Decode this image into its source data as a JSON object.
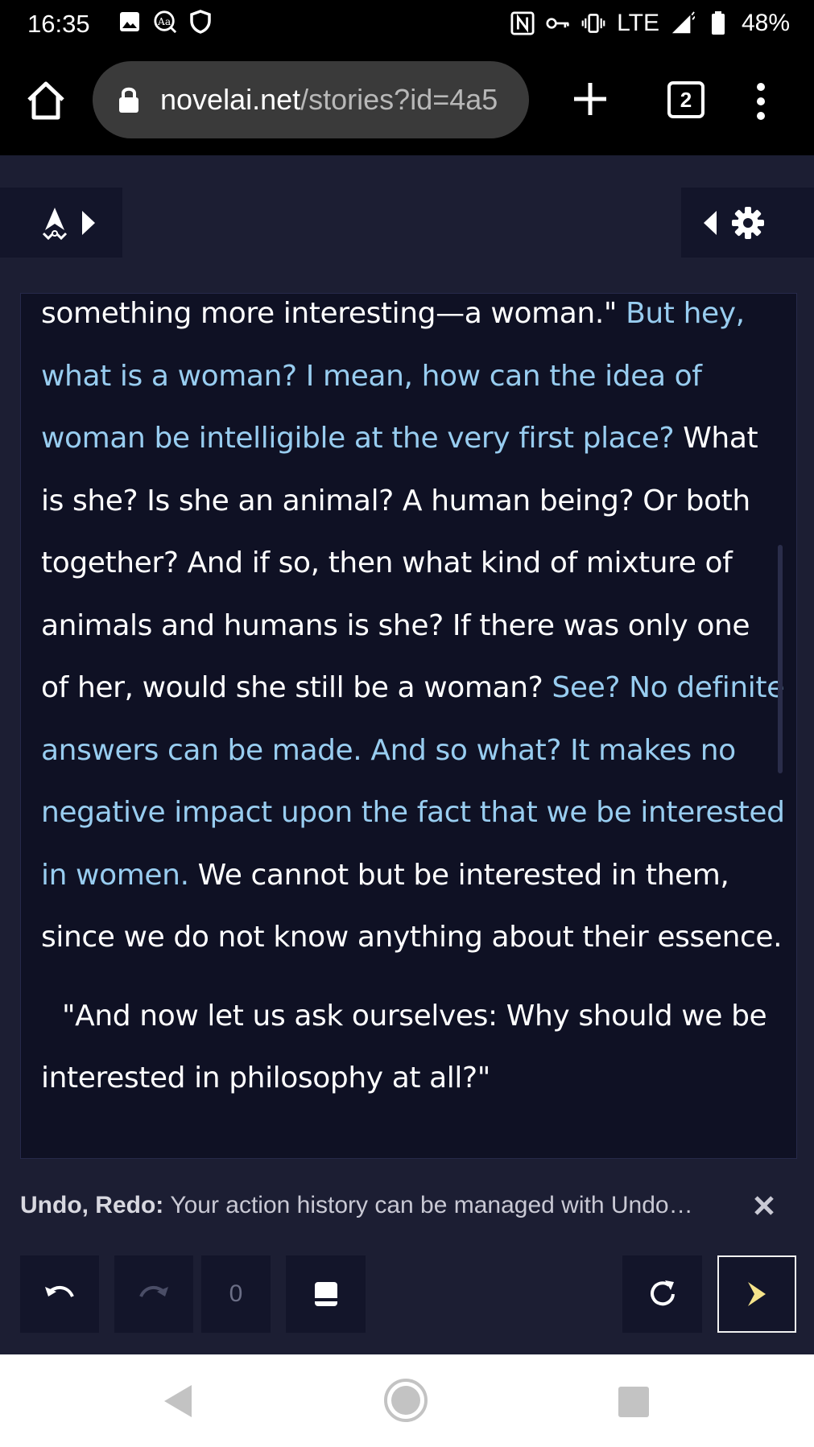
{
  "status_bar": {
    "time": "16:35",
    "network": "LTE",
    "battery": "48%",
    "left_icons": [
      "image-icon",
      "font-icon",
      "shield-icon"
    ],
    "right_icons": [
      "nfc-icon",
      "vpn-key-icon",
      "vibrate-icon",
      "signal-icon",
      "battery-icon"
    ]
  },
  "browser": {
    "url_domain": "novelai.net",
    "url_path": "/stories?id=4a5",
    "tab_count": "2"
  },
  "story": {
    "paragraph1": [
      {
        "text": "something more interesting—a woman.\" ",
        "ai": false
      },
      {
        "text": "But hey, what is a woman? I mean, how can the idea of woman be intelligible at the very first place?",
        "ai": true
      },
      {
        "text": " What is she? Is she an animal? A human being? Or both together? And if so, then what kind of mixture of animals and humans is she? If there was only one of her, would she still be a woman? ",
        "ai": false
      },
      {
        "text": "See? No definite answers can be made. And so what? It makes no negative impact upon the fact that we be interested in women.",
        "ai": true
      },
      {
        "text": " We cannot but be interested in them, since we do not know anything about their essence.",
        "ai": false
      }
    ],
    "paragraph2": "\"And now let us ask ourselves: Why should we be interested in philosophy at all?\""
  },
  "tip": {
    "title": "Undo, Redo:",
    "text": "Your action history can be managed with Undo…"
  },
  "bottom_bar": {
    "retry_count": "0"
  },
  "colors": {
    "background": "#1c1e33",
    "panel": "#0f1124",
    "ai_text": "#98cdf0",
    "user_text": "#ffffff"
  }
}
